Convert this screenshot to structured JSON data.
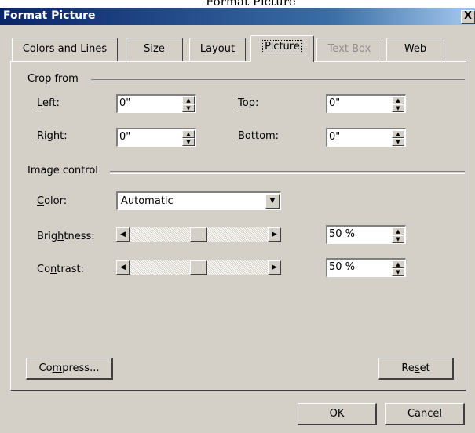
{
  "top_text": "Format Picture",
  "window": {
    "title": "Format Picture",
    "close_glyph": "X"
  },
  "tabs": [
    {
      "label": "Colors and Lines"
    },
    {
      "label": "Size"
    },
    {
      "label": "Layout"
    },
    {
      "label": "Picture"
    },
    {
      "label": "Text Box"
    },
    {
      "label": "Web"
    }
  ],
  "crop": {
    "heading": "Crop from",
    "left": {
      "pre": "",
      "key": "L",
      "post": "eft:",
      "value": "0\""
    },
    "right": {
      "pre": "",
      "key": "R",
      "post": "ight:",
      "value": "0\""
    },
    "top": {
      "pre": "",
      "key": "T",
      "post": "op:",
      "value": "0\""
    },
    "bottom": {
      "pre": "",
      "key": "B",
      "post": "ottom:",
      "value": "0\""
    }
  },
  "image_control": {
    "heading": "Image control",
    "color": {
      "pre": "",
      "key": "C",
      "post": "olor:",
      "value": "Automatic"
    },
    "brightness": {
      "pre": "Brig",
      "key": "h",
      "post": "tness:",
      "value": "50 %",
      "level": 0.5
    },
    "contrast": {
      "pre": "Co",
      "key": "n",
      "post": "trast:",
      "value": "50 %",
      "level": 0.5
    }
  },
  "buttons": {
    "compress": {
      "pre": "Co",
      "key": "m",
      "post": "press..."
    },
    "reset": {
      "pre": "Re",
      "key": "s",
      "post": "et"
    },
    "ok": "OK",
    "cancel": "Cancel"
  }
}
